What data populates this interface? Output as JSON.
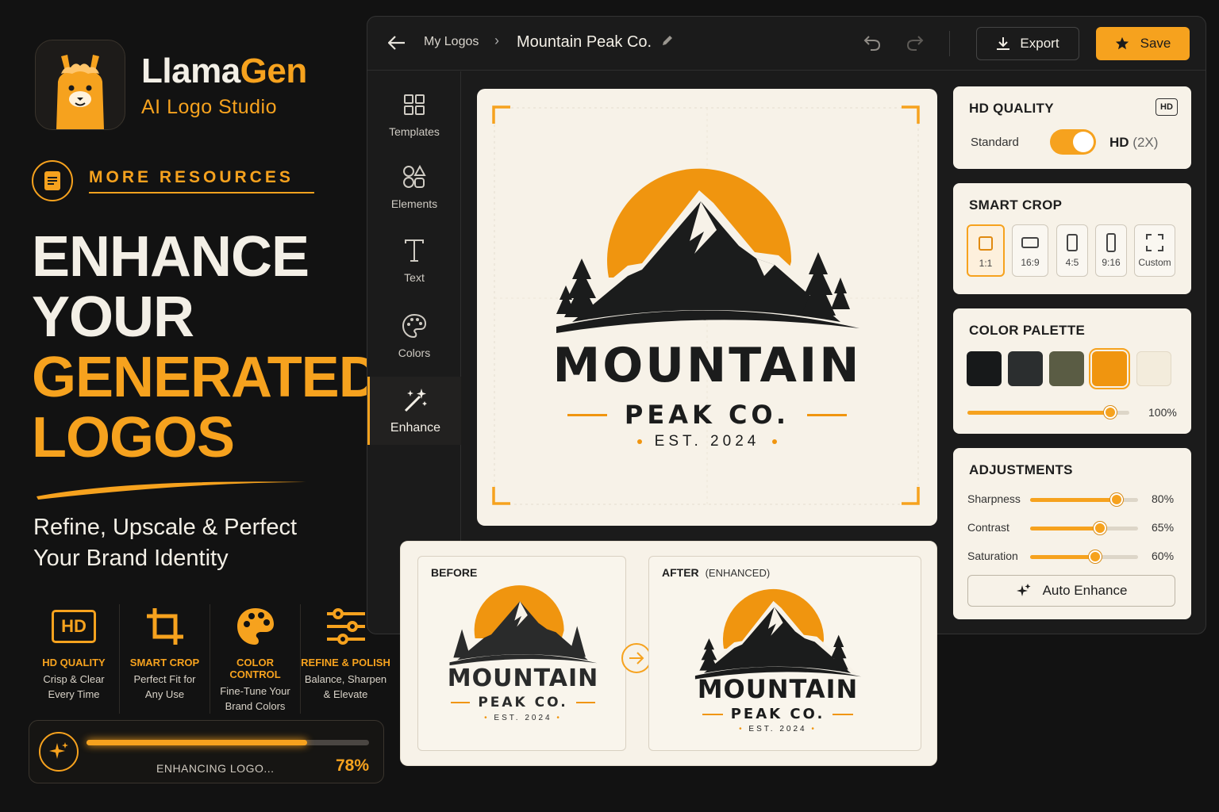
{
  "brand": {
    "name_part1": "Llama",
    "name_part2": "Gen",
    "subtitle": "AI Logo Studio"
  },
  "resources": {
    "label": "MORE RESOURCES"
  },
  "headline": {
    "line1": "ENHANCE",
    "line2": "YOUR",
    "line3": "GENERATED",
    "line4": "LOGOS"
  },
  "tagline": {
    "line1": "Refine, Upscale & Perfect",
    "line2": "Your Brand Identity"
  },
  "features": [
    {
      "icon": "hd-icon",
      "icon_text": "HD",
      "title": "HD QUALITY",
      "desc1": "Crisp & Clear",
      "desc2": "Every Time"
    },
    {
      "icon": "crop-icon",
      "title": "SMART CROP",
      "desc1": "Perfect Fit for",
      "desc2": "Any Use"
    },
    {
      "icon": "palette-icon",
      "title": "COLOR CONTROL",
      "desc1": "Fine-Tune Your",
      "desc2": "Brand Colors"
    },
    {
      "icon": "sliders-icon",
      "title": "REFINE & POLISH",
      "desc1": "Balance, Sharpen",
      "desc2": "& Elevate"
    }
  ],
  "progress": {
    "label": "ENHANCING LOGO...",
    "percent_text": "78%",
    "value": 0.78
  },
  "topbar": {
    "breadcrumb": "My Logos",
    "title": "Mountain Peak Co.",
    "export_label": "Export",
    "save_label": "Save"
  },
  "tools": [
    {
      "icon": "grid-icon",
      "label": "Templates"
    },
    {
      "icon": "shapes-icon",
      "label": "Elements"
    },
    {
      "icon": "text-icon",
      "label": "Text"
    },
    {
      "icon": "palette-icon",
      "label": "Colors"
    },
    {
      "icon": "magic-wand-icon",
      "label": "Enhance",
      "active": true
    }
  ],
  "logo": {
    "name": "MOUNTAIN",
    "sub": "PEAK CO.",
    "est": "EST. 2024"
  },
  "hd_panel": {
    "title": "HD QUALITY",
    "badge": "HD",
    "standard_label": "Standard",
    "hd_label": "HD",
    "hd_scale": "(2X)",
    "enabled": true
  },
  "crop_panel": {
    "title": "SMART CROP",
    "options": [
      "1:1",
      "16:9",
      "4:5",
      "9:16",
      "Custom"
    ],
    "selected": "1:1"
  },
  "palette_panel": {
    "title": "COLOR PALETTE",
    "swatches": [
      "#17191a",
      "#2b2e2f",
      "#5a5c44",
      "#f0950f",
      "#f3ecdc"
    ],
    "selected_index": 3,
    "opacity_text": "100%",
    "opacity_value": 0.88
  },
  "adjustments": {
    "title": "ADJUSTMENTS",
    "items": [
      {
        "label": "Sharpness",
        "value": 80,
        "text": "80%"
      },
      {
        "label": "Contrast",
        "value": 65,
        "text": "65%"
      },
      {
        "label": "Saturation",
        "value": 60,
        "text": "60%"
      }
    ],
    "auto_label": "Auto Enhance"
  },
  "compare": {
    "before_label": "BEFORE",
    "after_label": "AFTER",
    "after_note": "(ENHANCED)"
  },
  "colors": {
    "accent": "#f6a21e",
    "dark": "#121212",
    "cream": "#f7f2e8",
    "ink": "#1e1e1e"
  }
}
